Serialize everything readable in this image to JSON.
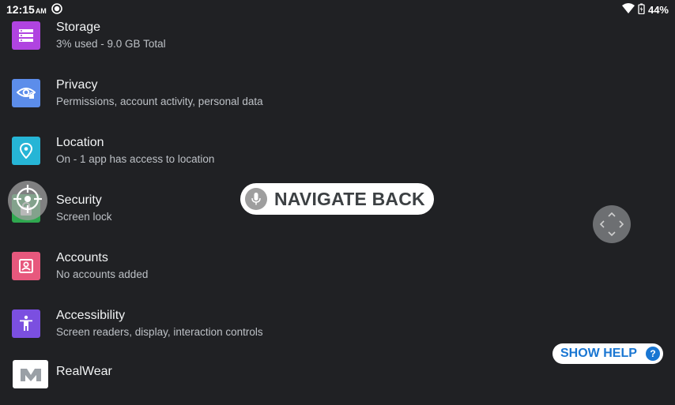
{
  "status": {
    "time": "12:15",
    "ampm": "AM",
    "battery": "44%"
  },
  "settings": [
    {
      "title": "Storage",
      "subtitle": "3% used - 9.0 GB Total",
      "icon": "storage-icon",
      "color": "#b044e0"
    },
    {
      "title": "Privacy",
      "subtitle": "Permissions, account activity, personal data",
      "icon": "privacy-eye-icon",
      "color": "#5c8dea"
    },
    {
      "title": "Location",
      "subtitle": "On - 1 app has access to location",
      "icon": "location-pin-icon",
      "color": "#26b5d6"
    },
    {
      "title": "Security",
      "subtitle": "Screen lock",
      "icon": "lock-icon",
      "color": "#2fa84f"
    },
    {
      "title": "Accounts",
      "subtitle": "No accounts added",
      "icon": "account-icon",
      "color": "#e7587d"
    },
    {
      "title": "Accessibility",
      "subtitle": "Screen readers, display, interaction controls",
      "icon": "accessibility-icon",
      "color": "#7b4fe0"
    },
    {
      "title": "RealWear",
      "subtitle": "",
      "icon": "realwear-logo-icon",
      "color": "#ffffff"
    }
  ],
  "overlay": {
    "navigate_back": "NAVIGATE BACK",
    "show_help": "SHOW HELP",
    "help_q": "?"
  }
}
